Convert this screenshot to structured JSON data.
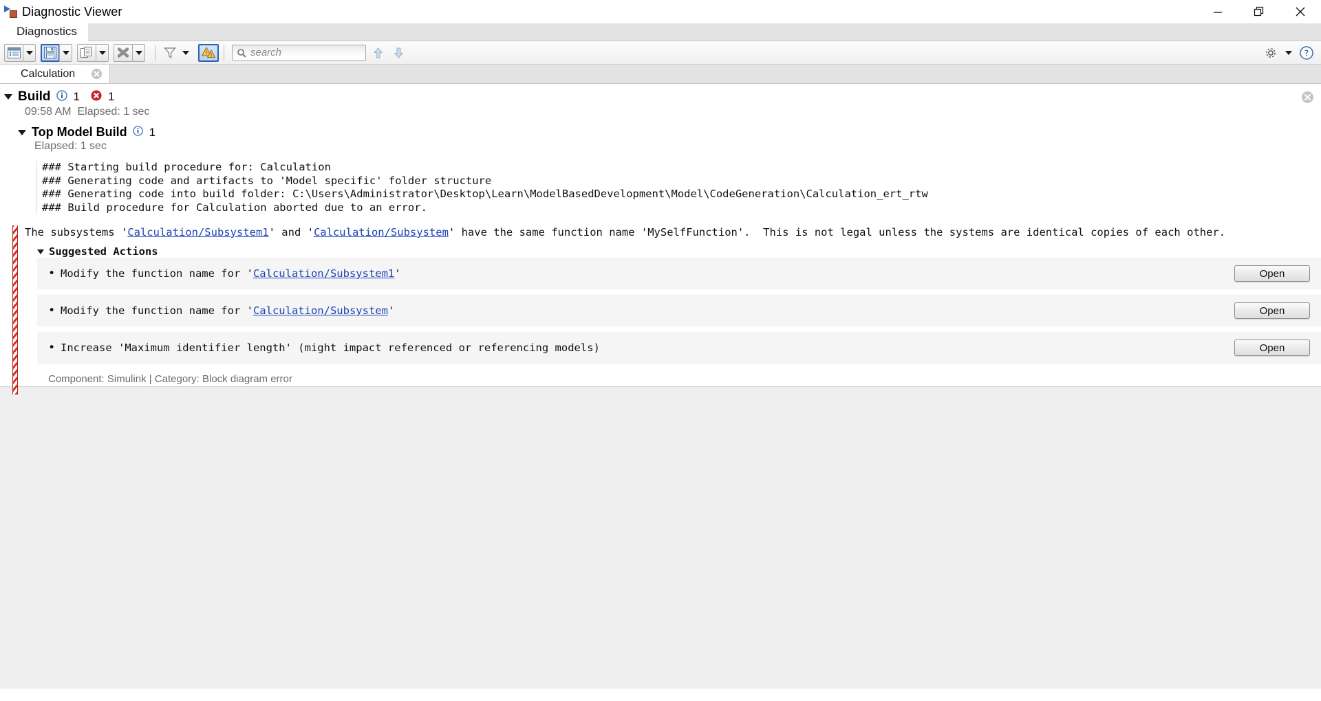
{
  "window": {
    "title": "Diagnostic Viewer",
    "app_icon": "simulink-diagnostic-icon",
    "controls": {
      "minimize": "minimize-button",
      "restore": "restore-button",
      "close": "close-button"
    }
  },
  "menustrip": {
    "tabs": [
      {
        "label": "Diagnostics"
      }
    ]
  },
  "toolbar": {
    "buttons": [
      {
        "name": "view-layout-button",
        "icon": "list-view-icon",
        "selected": false
      },
      {
        "name": "view-layout-dropdown",
        "icon": "chevron-down-icon",
        "selected": false
      },
      {
        "name": "save-button",
        "icon": "save-floppy-icon",
        "selected": true
      },
      {
        "name": "save-dropdown",
        "icon": "chevron-down-icon",
        "selected": false
      },
      {
        "name": "copy-button",
        "icon": "copy-icon",
        "selected": false
      },
      {
        "name": "copy-dropdown",
        "icon": "chevron-down-icon",
        "selected": false
      },
      {
        "name": "clear-button",
        "icon": "delete-x-icon",
        "selected": false
      },
      {
        "name": "clear-dropdown",
        "icon": "chevron-down-icon",
        "selected": false
      },
      {
        "name": "filter-button",
        "icon": "filter-funnel-icon",
        "selected": false
      },
      {
        "name": "filter-dropdown",
        "icon": "chevron-down-icon",
        "selected": false
      },
      {
        "name": "warnings-button",
        "icon": "warning-triangles-icon",
        "selected": true
      }
    ],
    "search": {
      "placeholder": "search",
      "value": "",
      "icon": "search-magnifier-icon"
    },
    "nav": {
      "previous": "arrow-up-icon",
      "next": "arrow-down-icon"
    },
    "right": {
      "settings": "gear-icon",
      "settings_dropdown": "chevron-down-icon",
      "help": "help-question-icon"
    }
  },
  "doctabs": {
    "tabs": [
      {
        "label": "Calculation",
        "close_icon": "tab-close-icon",
        "active": true
      }
    ]
  },
  "build": {
    "title": "Build",
    "info_count": "1",
    "error_count": "1",
    "time": "09:58 AM",
    "elapsed": "Elapsed: 1 sec",
    "close_icon": "panel-close-icon",
    "top_model_build": {
      "title": "Top Model Build",
      "info_count": "1",
      "elapsed": "Elapsed: 1 sec"
    },
    "log_lines": [
      "### Starting build procedure for: Calculation",
      "### Generating code and artifacts to 'Model specific' folder structure",
      "### Generating code into build folder: C:\\Users\\Administrator\\Desktop\\Learn\\ModelBasedDevelopment\\Model\\CodeGeneration\\Calculation_ert_rtw",
      "### Build procedure for Calculation aborted due to an error."
    ]
  },
  "error": {
    "message_parts": [
      {
        "type": "text",
        "text": "The subsystems '"
      },
      {
        "type": "link",
        "text": "Calculation/Subsystem1"
      },
      {
        "type": "text",
        "text": "' and '"
      },
      {
        "type": "link",
        "text": "Calculation/Subsystem"
      },
      {
        "type": "text",
        "text": "' have the same function name 'MySelfFunction'.  This is not legal unless the systems are identical copies of each other."
      }
    ],
    "suggested_actions_title": "Suggested Actions",
    "actions": [
      {
        "parts": [
          {
            "type": "text",
            "text": "Modify the function name for '"
          },
          {
            "type": "link",
            "text": "Calculation/Subsystem1"
          },
          {
            "type": "text",
            "text": "'"
          }
        ],
        "button_label": "Open"
      },
      {
        "parts": [
          {
            "type": "text",
            "text": "Modify the function name for '"
          },
          {
            "type": "link",
            "text": "Calculation/Subsystem"
          },
          {
            "type": "text",
            "text": "'"
          }
        ],
        "button_label": "Open"
      },
      {
        "parts": [
          {
            "type": "text",
            "text": "Increase 'Maximum identifier length' (might impact referenced or referencing models)"
          }
        ],
        "button_label": "Open"
      }
    ],
    "footer": "Component: Simulink | Category: Block diagram error"
  },
  "colors": {
    "link": "#1a41b8",
    "error_red": "#d93025",
    "accent_blue": "#2c62b5",
    "muted_text": "#6b6b6b",
    "toolbar_bg": "#f0f0f0",
    "tabstrip_bg": "#e3e3e3",
    "action_row_bg": "#f5f5f5",
    "bottom_fill": "#efefef"
  }
}
